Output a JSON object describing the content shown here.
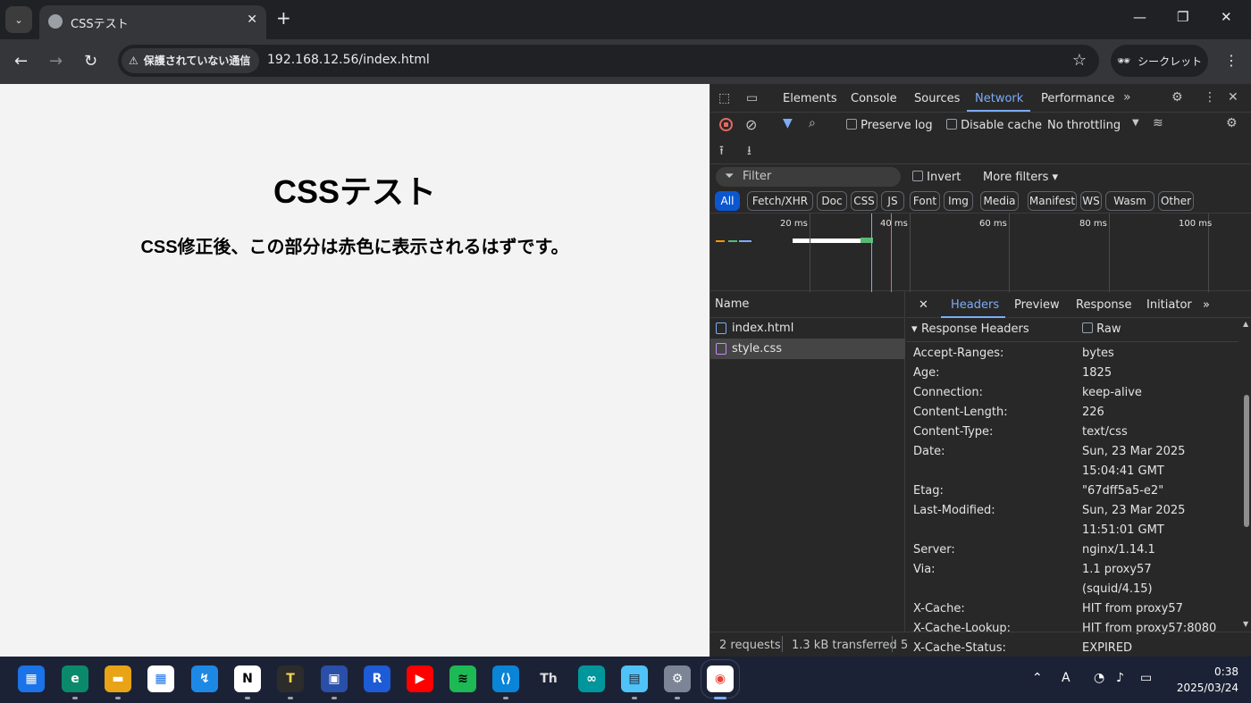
{
  "browser": {
    "tab_title": "CSSテスト",
    "tab_close": "✕",
    "new_tab": "+",
    "security_label": "保護されていない通信",
    "url": "192.168.12.56/index.html",
    "incognito_label": "シークレット"
  },
  "page": {
    "heading": "CSSテスト",
    "paragraph": "CSS修正後、この部分は赤色に表示されるはずです。"
  },
  "devtools": {
    "tabs": [
      "Elements",
      "Console",
      "Sources",
      "Network",
      "Performance"
    ],
    "active_tab": "Network",
    "toolbar": {
      "preserve_log": "Preserve log",
      "disable_cache": "Disable cache",
      "throttling": "No throttling"
    },
    "filter": {
      "placeholder": "Filter",
      "invert": "Invert",
      "more_filters": "More filters"
    },
    "types": [
      "All",
      "Fetch/XHR",
      "Doc",
      "CSS",
      "JS",
      "Font",
      "Img",
      "Media",
      "Manifest",
      "WS",
      "Wasm",
      "Other"
    ],
    "active_type": "All",
    "timeline_ticks": [
      "20 ms",
      "40 ms",
      "60 ms",
      "80 ms",
      "100 ms"
    ],
    "list": {
      "header": "Name",
      "items": [
        "index.html",
        "style.css"
      ],
      "selected": "style.css"
    },
    "detail": {
      "tabs": [
        "Headers",
        "Preview",
        "Response",
        "Initiator"
      ],
      "active_tab": "Headers",
      "section": "Response Headers",
      "raw_label": "Raw",
      "headers": [
        {
          "name": "Accept-Ranges:",
          "value": [
            "bytes"
          ]
        },
        {
          "name": "Age:",
          "value": [
            "1825"
          ]
        },
        {
          "name": "Connection:",
          "value": [
            "keep-alive"
          ]
        },
        {
          "name": "Content-Length:",
          "value": [
            "226"
          ]
        },
        {
          "name": "Content-Type:",
          "value": [
            "text/css"
          ]
        },
        {
          "name": "Date:",
          "value": [
            "Sun, 23 Mar 2025",
            "15:04:41 GMT"
          ]
        },
        {
          "name": "Etag:",
          "value": [
            "\"67dff5a5-e2\""
          ]
        },
        {
          "name": "Last-Modified:",
          "value": [
            "Sun, 23 Mar 2025",
            "11:51:01 GMT"
          ]
        },
        {
          "name": "Server:",
          "value": [
            "nginx/1.14.1"
          ]
        },
        {
          "name": "Via:",
          "value": [
            "1.1 proxy57",
            "(squid/4.15)"
          ]
        },
        {
          "name": "X-Cache:",
          "value": [
            "HIT from proxy57"
          ]
        },
        {
          "name": "X-Cache-Lookup:",
          "value": [
            "HIT from proxy57:8080"
          ]
        },
        {
          "name": "X-Cache-Status:",
          "value": [
            "EXPIRED"
          ]
        }
      ]
    },
    "status": {
      "requests": "2 requests",
      "transferred": "1.3 kB transferred",
      "more": "5"
    }
  },
  "taskbar": {
    "apps": [
      "start",
      "edge",
      "file-explorer",
      "store",
      "app-5",
      "notion",
      "typora",
      "app-8",
      "app-9",
      "youtube",
      "spotify",
      "vscode",
      "app-13",
      "arduino",
      "notepad",
      "settings",
      "chrome"
    ],
    "time": "0:38",
    "date": "2025/03/24"
  },
  "colors": {
    "accent": "#7cacf8",
    "record": "#e46962",
    "taskbar": "#1c2236"
  }
}
